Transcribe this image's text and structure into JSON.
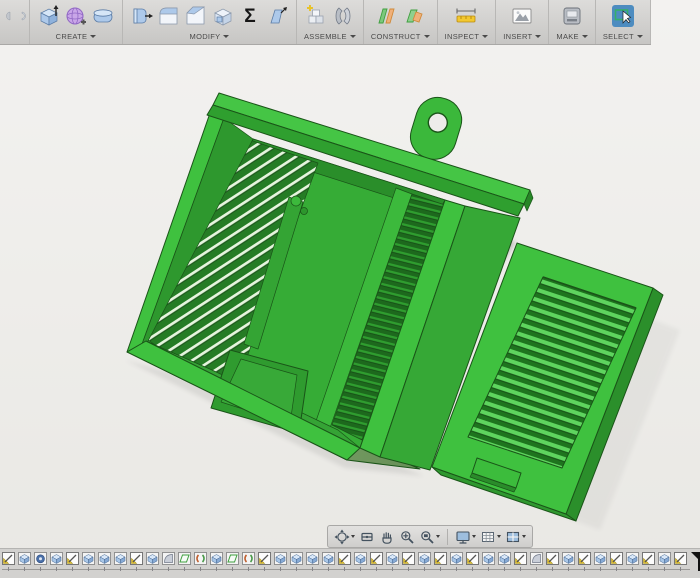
{
  "toolbar": {
    "sections": [
      {
        "id": "create",
        "label": "CREATE",
        "icons": [
          "extrude-box",
          "form-sphere",
          "revolve-slab"
        ]
      },
      {
        "id": "modify",
        "label": "MODIFY",
        "icons": [
          "press-pull",
          "fillet",
          "chamfer",
          "shell",
          "parameters-sigma",
          "draft"
        ]
      },
      {
        "id": "assemble",
        "label": "ASSEMBLE",
        "icons": [
          "new-component",
          "joint"
        ]
      },
      {
        "id": "construct",
        "label": "CONSTRUCT",
        "icons": [
          "construction-plane",
          "midplane"
        ]
      },
      {
        "id": "inspect",
        "label": "INSPECT",
        "icons": [
          "measure"
        ]
      },
      {
        "id": "insert",
        "label": "INSERT",
        "icons": [
          "insert-image"
        ]
      },
      {
        "id": "make",
        "label": "MAKE",
        "icons": [
          "3d-print"
        ]
      },
      {
        "id": "select",
        "label": "SELECT",
        "icons": [
          "select-tool"
        ]
      }
    ],
    "partial_left_icons": [
      "clipped-icon-a",
      "clipped-icon-b"
    ],
    "sigma_glyph": "Σ"
  },
  "navbar": {
    "items": [
      {
        "name": "orbit",
        "caret": true
      },
      {
        "name": "look-at",
        "caret": false
      },
      {
        "name": "pan",
        "caret": false
      },
      {
        "name": "zoom",
        "caret": false
      },
      {
        "name": "zoom-window",
        "caret": true
      },
      {
        "name": "separator",
        "sep": true
      },
      {
        "name": "display-settings",
        "caret": true
      },
      {
        "name": "grid-layout",
        "caret": true
      },
      {
        "name": "viewports",
        "caret": true
      }
    ]
  },
  "timeline": {
    "features": [
      "sketch",
      "extrude",
      "revolve",
      "extrude",
      "sketch",
      "extrude",
      "extrude",
      "extrude",
      "sketch",
      "extrude",
      "fillet",
      "plane",
      "joint",
      "extrude",
      "plane",
      "joint",
      "sketch",
      "extrude",
      "extrude",
      "extrude",
      "extrude",
      "sketch",
      "extrude",
      "sketch",
      "extrude",
      "sketch",
      "extrude",
      "sketch",
      "extrude",
      "sketch",
      "extrude",
      "extrude",
      "sketch",
      "fillet",
      "sketch",
      "extrude",
      "sketch",
      "extrude",
      "sketch",
      "extrude",
      "sketch",
      "extrude",
      "sketch"
    ],
    "has_playhead_marker": true
  },
  "viewport": {
    "model_parts": [
      "main-enclosure",
      "vent-cover"
    ]
  },
  "colors": {
    "model_lit": "#3fc13f",
    "model_lit2": "#45c545",
    "model_mid": "#36ac36",
    "model_dark": "#2c962c",
    "model_recess": "#1e701e",
    "model_outline": "#1a5418",
    "slat_light": "#e6f5de",
    "slat_cover": "#5ed45e",
    "bottom_face_a": "#8fb173",
    "bottom_face_b": "#678f58",
    "viewport_top": "#f3f2f0",
    "viewport_bottom": "#e9e8e4",
    "toolbar_top": "#dddcda",
    "toolbar_bottom": "#c7c6c4",
    "select_blue": "#4d8cc0",
    "timeline_bg": "#d2d1cf"
  }
}
